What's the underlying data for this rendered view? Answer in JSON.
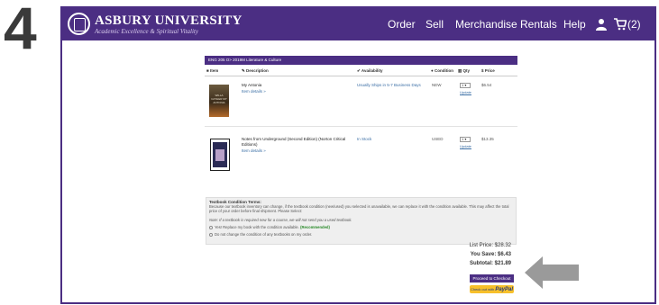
{
  "step_number": "4",
  "header": {
    "brand_name": "ASBURY UNIVERSITY",
    "brand_tagline": "Academic Excellence & Spiritual Vitality",
    "nav": [
      "Order",
      "Sell",
      "Merchandise",
      "Rentals",
      "Help"
    ],
    "cart_count": "(2)"
  },
  "course": {
    "label": "ENG  205  O>  2019M  Literature & Culture"
  },
  "table_headers": {
    "item": "Item",
    "description": "Description",
    "availability": "Availability",
    "condition": "Condition",
    "qty": "Qty",
    "price": "Price"
  },
  "items": [
    {
      "title": "My Antonia",
      "link": "Item details »",
      "availability": "Usually Ships in 5-7 Business Days",
      "condition": "NEW",
      "qty": "1",
      "update": "Update",
      "price": "$6.54",
      "cover_text": "WILLA CATHER MY ANTONIA"
    },
    {
      "title": "Notes from Underground (Second Edition) (Norton Critical Editions)",
      "link": "Item details »",
      "availability": "In Stock",
      "condition": "USED",
      "qty": "1",
      "update": "Update",
      "price": "$13.35"
    }
  ],
  "terms": {
    "title": "Textbook Condition Terms:",
    "text": "Because our textbook inventory can change, if the textbook condition (new/used) you selected is unavailable, we can replace it with the condition available. This may affect the total price of your order before final shipment. Please Select:",
    "note": "Note: If a textbook is required new for a course, we will not send you a used textbook.",
    "option_yes": "Yes! Replace my book with the condition available.",
    "recommended": "(Recommended)",
    "option_no": "Do not change the condition of any textbooks on my order."
  },
  "summary": {
    "list_price": "List Price: $28.32",
    "you_save": "You Save: $6.43",
    "subtotal": "Subtotal: $21.89"
  },
  "checkout_label": "Proceed to Checkout",
  "paypal_prefix": "Check out with",
  "paypal_brand": "PayPal",
  "colors": {
    "brand_purple": "#4b2e83",
    "paypal_yellow": "#f7c02b",
    "arrow_gray": "#9a9a9a"
  }
}
